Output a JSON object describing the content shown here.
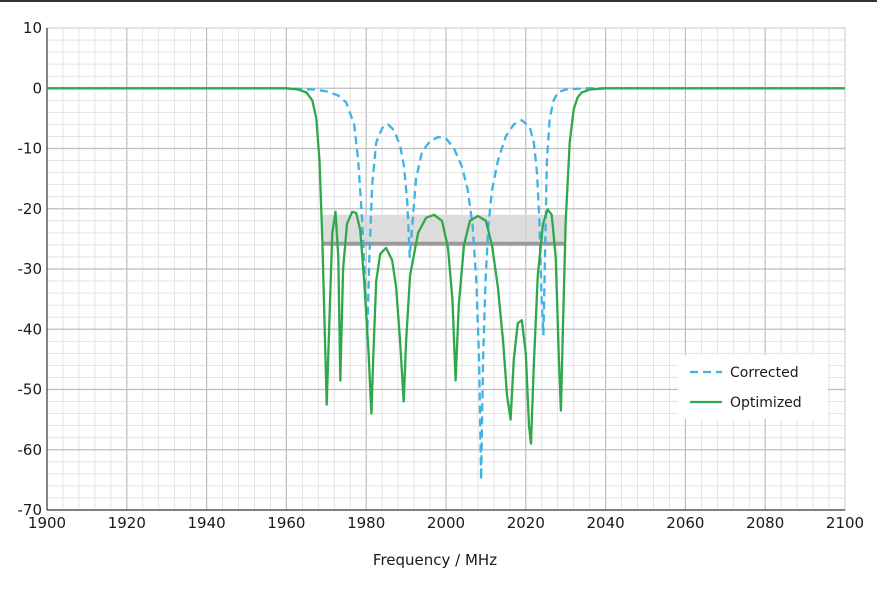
{
  "chart_data": {
    "type": "line",
    "title": "",
    "xlabel": "Frequency / MHz",
    "ylabel": "",
    "xlim": [
      1900,
      2100
    ],
    "ylim": [
      -70,
      10
    ],
    "x_ticks": [
      "1900",
      "1920",
      "1940",
      "1960",
      "1980",
      "2000",
      "2020",
      "2040",
      "2060",
      "2080",
      "2100"
    ],
    "y_ticks": [
      "10",
      "0",
      "-10",
      "-20",
      "-30",
      "-40",
      "-50",
      "-60",
      "-70"
    ],
    "grid": true,
    "legend_position": "bottom-right",
    "series": [
      {
        "name": "Corrected",
        "color": "#3db4e3",
        "style": "dashed",
        "x": [
          1900,
          1960,
          1967,
          1970,
          1973,
          1975,
          1977,
          1978,
          1979,
          1979.8,
          1980.3,
          1980.8,
          1981.5,
          1982.5,
          1984,
          1985.5,
          1987,
          1988.5,
          1989.5,
          1990.3,
          1990.9,
          1991.5,
          1992.5,
          1994,
          1996,
          1998,
          2000,
          2002,
          2004,
          2005.5,
          2006.7,
          2007.6,
          2008.3,
          2008.8,
          2009.3,
          2009.9,
          2010.6,
          2011.5,
          2013,
          2015,
          2017,
          2019,
          2021,
          2022,
          2022.8,
          2023.4,
          2023.9,
          2024.4,
          2024.8,
          2025.3,
          2026,
          2027,
          2028,
          2030,
          2035,
          2100
        ],
        "y": [
          0,
          0,
          -0.2,
          -0.5,
          -1.2,
          -2.4,
          -6,
          -12,
          -22,
          -34,
          -40,
          -28,
          -16,
          -9,
          -6.6,
          -6,
          -7,
          -9.5,
          -13,
          -19,
          -28,
          -23,
          -15,
          -10.5,
          -8.8,
          -8.1,
          -8.3,
          -10,
          -13,
          -17,
          -23,
          -32,
          -45,
          -65,
          -45,
          -32,
          -23,
          -17,
          -12,
          -8,
          -6,
          -5.3,
          -6.5,
          -9,
          -14,
          -22,
          -34,
          -41,
          -28,
          -12,
          -5,
          -2,
          -0.7,
          -0.2,
          0,
          0
        ]
      },
      {
        "name": "Optimized",
        "color": "#2ea84b",
        "style": "solid",
        "x": [
          1900,
          1960,
          1963,
          1965,
          1966.5,
          1967.5,
          1968.3,
          1969,
          1969.6,
          1970.1,
          1970.8,
          1971.5,
          1972.3,
          1973.0,
          1973.5,
          1974.2,
          1975.2,
          1976.5,
          1977.5,
          1978.5,
          1979.5,
          1980.6,
          1981.3,
          1981.8,
          1982.5,
          1983.5,
          1985,
          1986.5,
          1987.5,
          1988.5,
          1989.4,
          1990,
          1991,
          1993,
          1995,
          1997,
          1999,
          2000.5,
          2001.6,
          2002.4,
          2003.2,
          2004.5,
          2006,
          2008,
          2010,
          2011.5,
          2013,
          2014.3,
          2015.3,
          2016.2,
          2017,
          2018,
          2019,
          2020,
          2020.8,
          2021.3,
          2022,
          2023,
          2024.3,
          2025.5,
          2026.5,
          2027.5,
          2028.3,
          2028.8,
          2029.3,
          2030,
          2031,
          2032,
          2033,
          2034,
          2036,
          2040,
          2100
        ],
        "y": [
          0,
          0,
          -0.2,
          -0.7,
          -2,
          -5,
          -12,
          -25,
          -40,
          -52.5,
          -38,
          -24,
          -20.5,
          -28,
          -48.5,
          -30,
          -22.5,
          -20.5,
          -20.7,
          -23.5,
          -32,
          -44,
          -54,
          -44,
          -32,
          -27.5,
          -26.5,
          -28.5,
          -33,
          -42,
          -52,
          -42,
          -31,
          -24,
          -21.5,
          -21,
          -22,
          -26.5,
          -35,
          -48.5,
          -36,
          -26,
          -22,
          -21.2,
          -22,
          -26,
          -33,
          -42,
          -51,
          -55,
          -45,
          -39,
          -38.5,
          -44,
          -56,
          -59,
          -46,
          -31,
          -22.5,
          -20.1,
          -21,
          -28,
          -45,
          -53.5,
          -40,
          -22,
          -9,
          -3.5,
          -1.5,
          -0.7,
          -0.2,
          0,
          0
        ]
      }
    ],
    "shaded_band": {
      "x": [
        1969,
        2030
      ],
      "y": [
        -25.8,
        -21
      ],
      "line_y": -25.8,
      "fill": "#d4d4d4",
      "line_color": "#9a9a9a"
    }
  }
}
